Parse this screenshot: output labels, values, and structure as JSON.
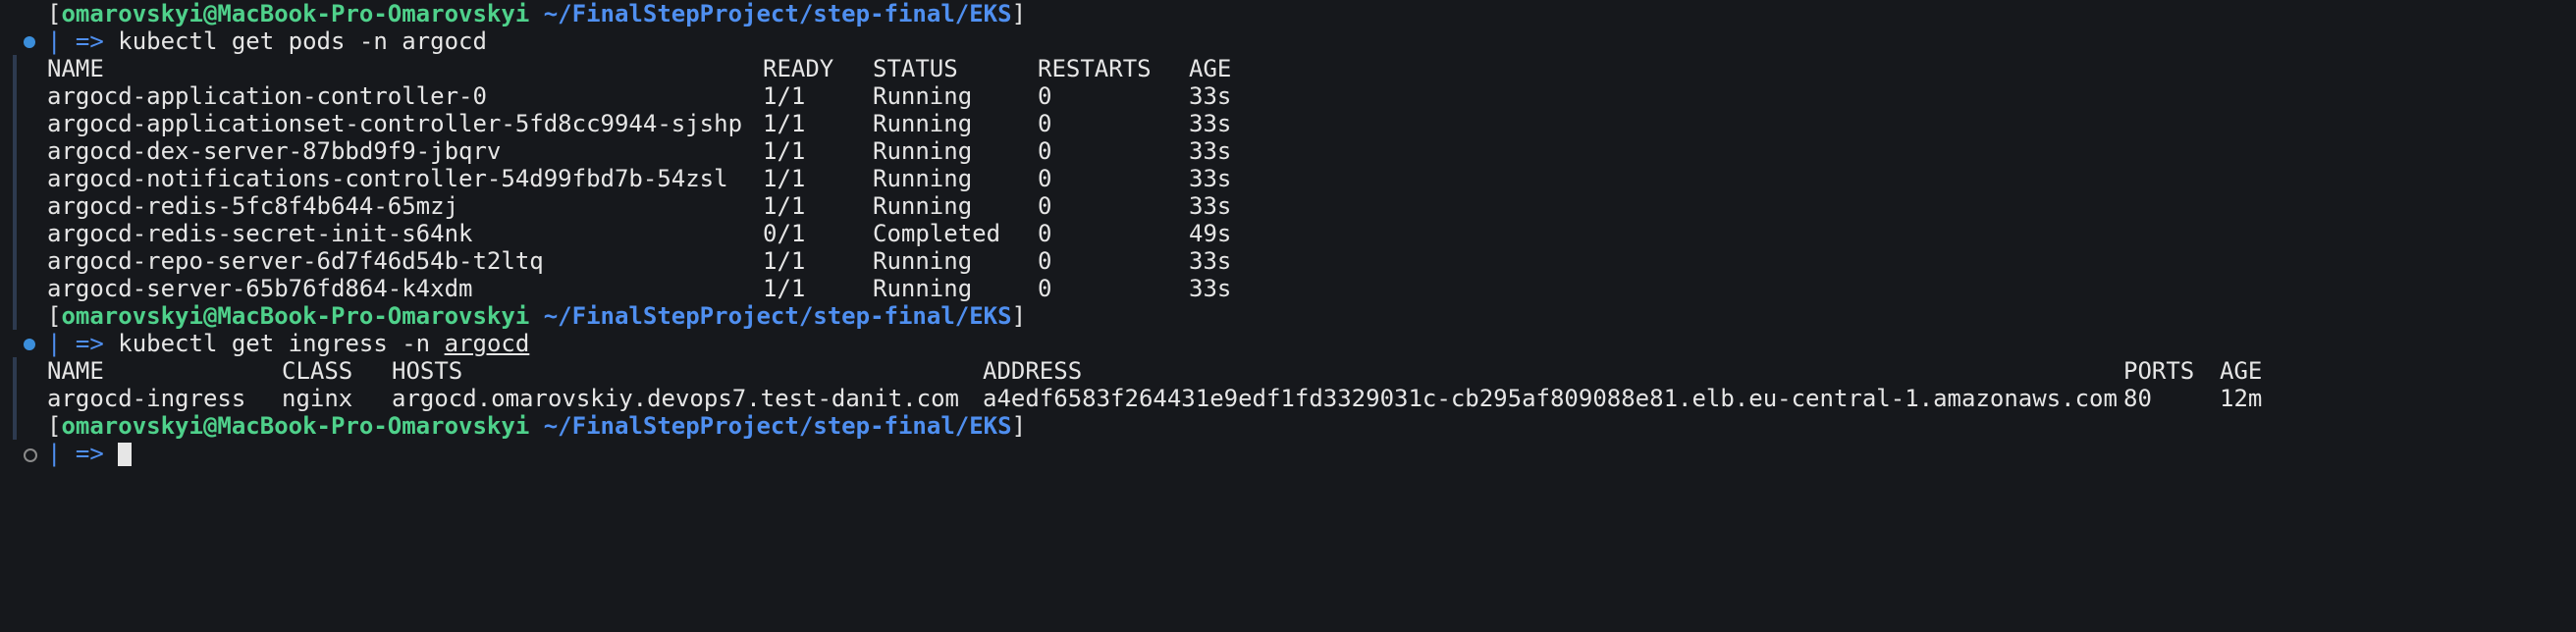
{
  "prompt_user": "omarovskyi@MacBook-Pro-Omarovskyi",
  "prompt_path": "~/FinalStepProject/step-final/EKS",
  "prompt_symbol": "| =>",
  "cmd1": "kubectl get pods -n argocd",
  "pods": {
    "headers": [
      "NAME",
      "READY",
      "STATUS",
      "RESTARTS",
      "AGE"
    ],
    "rows": [
      [
        "argocd-application-controller-0",
        "1/1",
        "Running",
        "0",
        "33s"
      ],
      [
        "argocd-applicationset-controller-5fd8cc9944-sjshp",
        "1/1",
        "Running",
        "0",
        "33s"
      ],
      [
        "argocd-dex-server-87bbd9f9-jbqrv",
        "1/1",
        "Running",
        "0",
        "33s"
      ],
      [
        "argocd-notifications-controller-54d99fbd7b-54zsl",
        "1/1",
        "Running",
        "0",
        "33s"
      ],
      [
        "argocd-redis-5fc8f4b644-65mzj",
        "1/1",
        "Running",
        "0",
        "33s"
      ],
      [
        "argocd-redis-secret-init-s64nk",
        "0/1",
        "Completed",
        "0",
        "49s"
      ],
      [
        "argocd-repo-server-6d7f46d54b-t2ltq",
        "1/1",
        "Running",
        "0",
        "33s"
      ],
      [
        "argocd-server-65b76fd864-k4xdm",
        "1/1",
        "Running",
        "0",
        "33s"
      ]
    ]
  },
  "cmd2_prefix": "kubectl get ingress -n ",
  "cmd2_arg": "argocd",
  "ingress": {
    "headers": [
      "NAME",
      "CLASS",
      "HOSTS",
      "ADDRESS",
      "PORTS",
      "AGE"
    ],
    "row": [
      "argocd-ingress",
      "nginx",
      "argocd.omarovskiy.devops7.test-danit.com",
      "a4edf6583f264431e9edf1fd3329031c-cb295af809088e81.elb.eu-central-1.amazonaws.com",
      "80",
      "12m"
    ]
  },
  "colors": {
    "background": "#16181c",
    "user": "#4fd18b",
    "path": "#4f8ff0",
    "dot": "#3b8edb"
  }
}
